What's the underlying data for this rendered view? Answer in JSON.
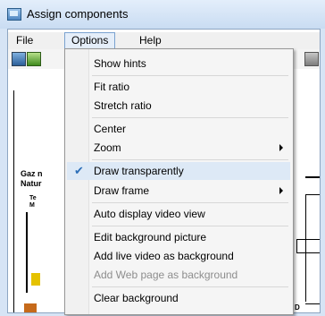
{
  "window": {
    "title": "Assign components"
  },
  "menubar": {
    "items": [
      "File",
      "Options",
      "Help"
    ],
    "active": "Options"
  },
  "canvas": {
    "labels": [
      "Gaz n",
      "Natur",
      "Te",
      "M",
      "D"
    ]
  },
  "options_menu": {
    "items": [
      {
        "label": "Show hints",
        "enabled": true
      },
      {
        "label": "Fit ratio",
        "enabled": true
      },
      {
        "label": "Stretch ratio",
        "enabled": true
      },
      {
        "label": "Center",
        "enabled": true
      },
      {
        "label": "Zoom",
        "enabled": true,
        "submenu": true
      },
      {
        "label": "Draw transparently",
        "enabled": true,
        "checked": true
      },
      {
        "label": "Draw frame",
        "enabled": true,
        "submenu": true
      },
      {
        "label": "Auto display video view",
        "enabled": true
      },
      {
        "label": "Edit background picture",
        "enabled": true
      },
      {
        "label": "Add live video as background",
        "enabled": true
      },
      {
        "label": "Add Web page as background",
        "enabled": false
      },
      {
        "label": "Clear background",
        "enabled": true
      }
    ]
  },
  "icons": {
    "checkmark": "check-icon",
    "submenu_arrow": "chevron-right-icon"
  }
}
